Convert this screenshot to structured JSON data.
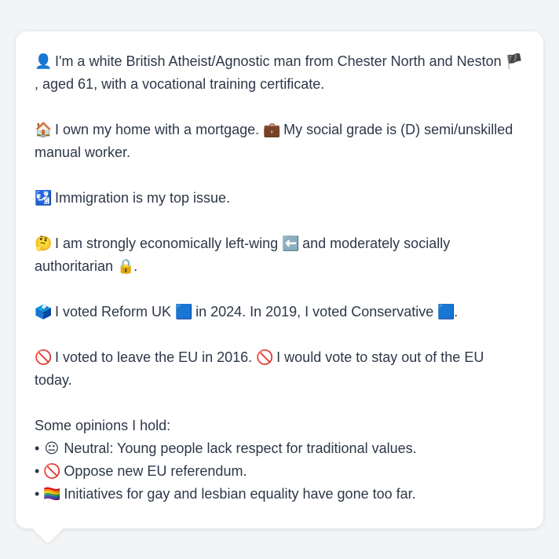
{
  "persona": {
    "intro": {
      "emoji_before": "👤",
      "text_a": " I'm a white British Atheist/Agnostic man from Chester North and Neston ",
      "emoji_mid": "🏴",
      "text_b": ", aged 61, with a vocational training certificate."
    },
    "housing": {
      "emoji_before": "🏠",
      "text_a": " I own my home with a mortgage. ",
      "emoji_mid": "💼",
      "text_b": " My social grade is (D) semi/unskilled manual worker."
    },
    "issue": {
      "emoji_before": "🛂",
      "text_a": " Immigration is my top issue."
    },
    "ideology": {
      "emoji_before": "🤔",
      "text_a": " I am strongly economically left-wing ",
      "emoji_mid": "⬅️",
      "text_b": " and moderately socially authoritarian ",
      "emoji_end": "🔒",
      "text_c": "."
    },
    "votes": {
      "emoji_before": "🗳️",
      "text_a": " I voted Reform UK ",
      "emoji_mid": "🟦",
      "text_b": " in 2024. In 2019, I voted Conservative ",
      "emoji_end": "🟦",
      "text_c": "."
    },
    "brexit": {
      "emoji_before": "🚫",
      "text_a": " I voted to leave the EU in 2016. ",
      "emoji_mid": "🚫",
      "text_b": " I would vote to stay out of the EU today."
    },
    "opinions_title": "Some opinions I hold:",
    "opinions": [
      {
        "bullet": "•",
        "emoji": "😐",
        "text": " Neutral: Young people lack respect for traditional values."
      },
      {
        "bullet": "•",
        "emoji": "🚫",
        "text": " Oppose new EU referendum."
      },
      {
        "bullet": "•",
        "emoji": "🏳️‍🌈",
        "text": " Initiatives for gay and lesbian equality have gone too far."
      }
    ]
  },
  "colors": {
    "background": "#f3f4f6",
    "bubble": "#ffffff",
    "text": "#2d3748"
  }
}
